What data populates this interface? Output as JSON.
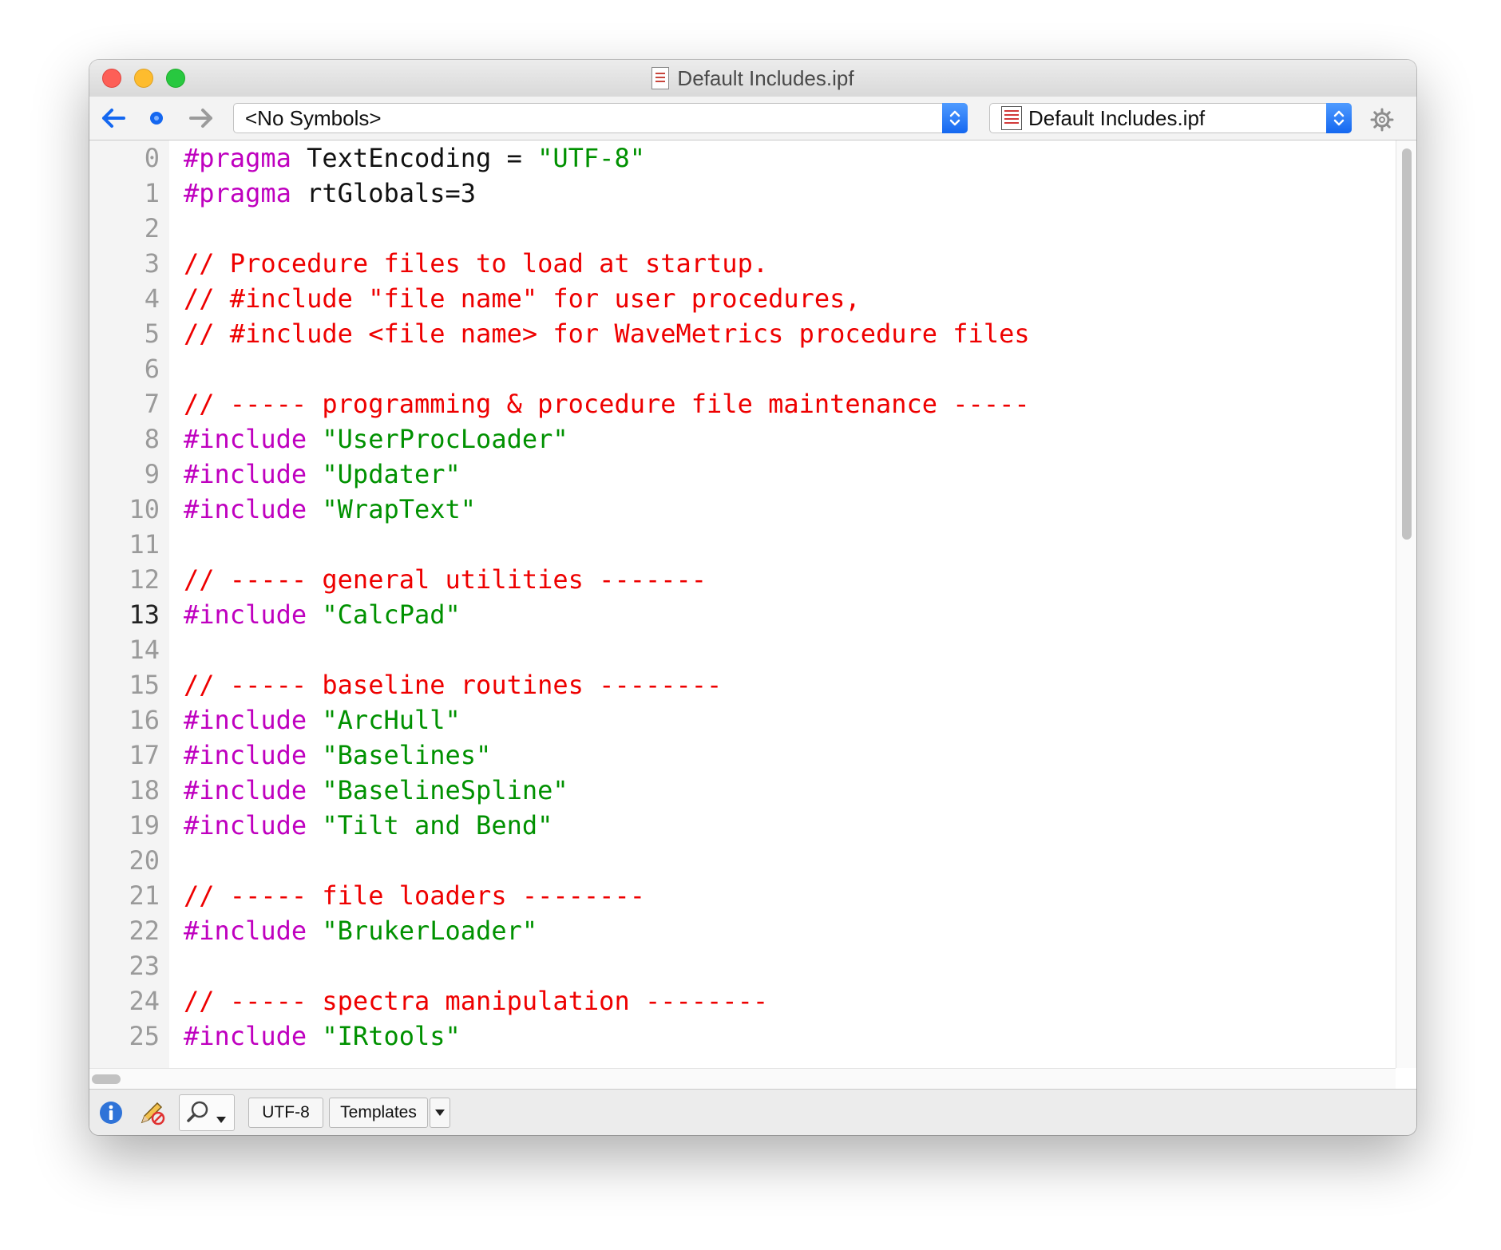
{
  "window": {
    "title": "Default Includes.ipf"
  },
  "toolbar": {
    "back_icon": "arrow-left-icon",
    "current_icon": "dot-icon",
    "forward_icon": "arrow-right-icon",
    "symbols_popup": "<No Symbols>",
    "file_popup": "Default Includes.ipf",
    "settings_icon": "gear-icon"
  },
  "editor": {
    "current_line": "13",
    "lines": [
      {
        "n": "0",
        "parts": [
          {
            "t": "#pragma",
            "k": "kw"
          },
          {
            "t": " TextEncoding = ",
            "k": "txt"
          },
          {
            "t": "\"UTF-8\"",
            "k": "str"
          }
        ]
      },
      {
        "n": "1",
        "parts": [
          {
            "t": "#pragma",
            "k": "kw"
          },
          {
            "t": " rtGlobals=3",
            "k": "txt"
          }
        ]
      },
      {
        "n": "2",
        "parts": []
      },
      {
        "n": "3",
        "parts": [
          {
            "t": "// Procedure files to load at startup.",
            "k": "com"
          }
        ]
      },
      {
        "n": "4",
        "parts": [
          {
            "t": "// #include \"file name\" for user procedures,",
            "k": "com"
          }
        ]
      },
      {
        "n": "5",
        "parts": [
          {
            "t": "// #include <file name> for WaveMetrics procedure files",
            "k": "com"
          }
        ]
      },
      {
        "n": "6",
        "parts": []
      },
      {
        "n": "7",
        "parts": [
          {
            "t": "// ----- programming & procedure file maintenance -----",
            "k": "com"
          }
        ]
      },
      {
        "n": "8",
        "parts": [
          {
            "t": "#include",
            "k": "kw"
          },
          {
            "t": " ",
            "k": "txt"
          },
          {
            "t": "\"UserProcLoader\"",
            "k": "str"
          }
        ]
      },
      {
        "n": "9",
        "parts": [
          {
            "t": "#include",
            "k": "kw"
          },
          {
            "t": " ",
            "k": "txt"
          },
          {
            "t": "\"Updater\"",
            "k": "str"
          }
        ]
      },
      {
        "n": "10",
        "parts": [
          {
            "t": "#include",
            "k": "kw"
          },
          {
            "t": " ",
            "k": "txt"
          },
          {
            "t": "\"WrapText\"",
            "k": "str"
          }
        ]
      },
      {
        "n": "11",
        "parts": []
      },
      {
        "n": "12",
        "parts": [
          {
            "t": "// ----- general utilities -------",
            "k": "com"
          }
        ]
      },
      {
        "n": "13",
        "parts": [
          {
            "t": "#include",
            "k": "kw"
          },
          {
            "t": " ",
            "k": "txt"
          },
          {
            "t": "\"CalcPad\"",
            "k": "str"
          }
        ]
      },
      {
        "n": "14",
        "parts": []
      },
      {
        "n": "15",
        "parts": [
          {
            "t": "// ----- baseline routines --------",
            "k": "com"
          }
        ]
      },
      {
        "n": "16",
        "parts": [
          {
            "t": "#include",
            "k": "kw"
          },
          {
            "t": " ",
            "k": "txt"
          },
          {
            "t": "\"ArcHull\"",
            "k": "str"
          }
        ]
      },
      {
        "n": "17",
        "parts": [
          {
            "t": "#include",
            "k": "kw"
          },
          {
            "t": " ",
            "k": "txt"
          },
          {
            "t": "\"Baselines\"",
            "k": "str"
          }
        ]
      },
      {
        "n": "18",
        "parts": [
          {
            "t": "#include",
            "k": "kw"
          },
          {
            "t": " ",
            "k": "txt"
          },
          {
            "t": "\"BaselineSpline\"",
            "k": "str"
          }
        ]
      },
      {
        "n": "19",
        "parts": [
          {
            "t": "#include",
            "k": "kw"
          },
          {
            "t": " ",
            "k": "txt"
          },
          {
            "t": "\"Tilt and Bend\"",
            "k": "str"
          }
        ]
      },
      {
        "n": "20",
        "parts": []
      },
      {
        "n": "21",
        "parts": [
          {
            "t": "// ----- file loaders --------",
            "k": "com"
          }
        ]
      },
      {
        "n": "22",
        "parts": [
          {
            "t": "#include",
            "k": "kw"
          },
          {
            "t": " ",
            "k": "txt"
          },
          {
            "t": "\"BrukerLoader\"",
            "k": "str"
          }
        ]
      },
      {
        "n": "23",
        "parts": []
      },
      {
        "n": "24",
        "parts": [
          {
            "t": "// ----- spectra manipulation --------",
            "k": "com"
          }
        ]
      },
      {
        "n": "25",
        "parts": [
          {
            "t": "#include",
            "k": "kw"
          },
          {
            "t": " ",
            "k": "txt"
          },
          {
            "t": "\"IRtools\"",
            "k": "str"
          }
        ]
      }
    ]
  },
  "statusbar": {
    "info_icon": "info-icon",
    "edit_icon": "pencil-no-edit-icon",
    "search_icon": "magnifier-icon",
    "encoding": "UTF-8",
    "templates": "Templates",
    "templates_menu_icon": "triangle-down-icon"
  },
  "colors": {
    "keyword": "#bf00bf",
    "string": "#009100",
    "comment": "#ee0000",
    "accent": "#1467f0"
  }
}
